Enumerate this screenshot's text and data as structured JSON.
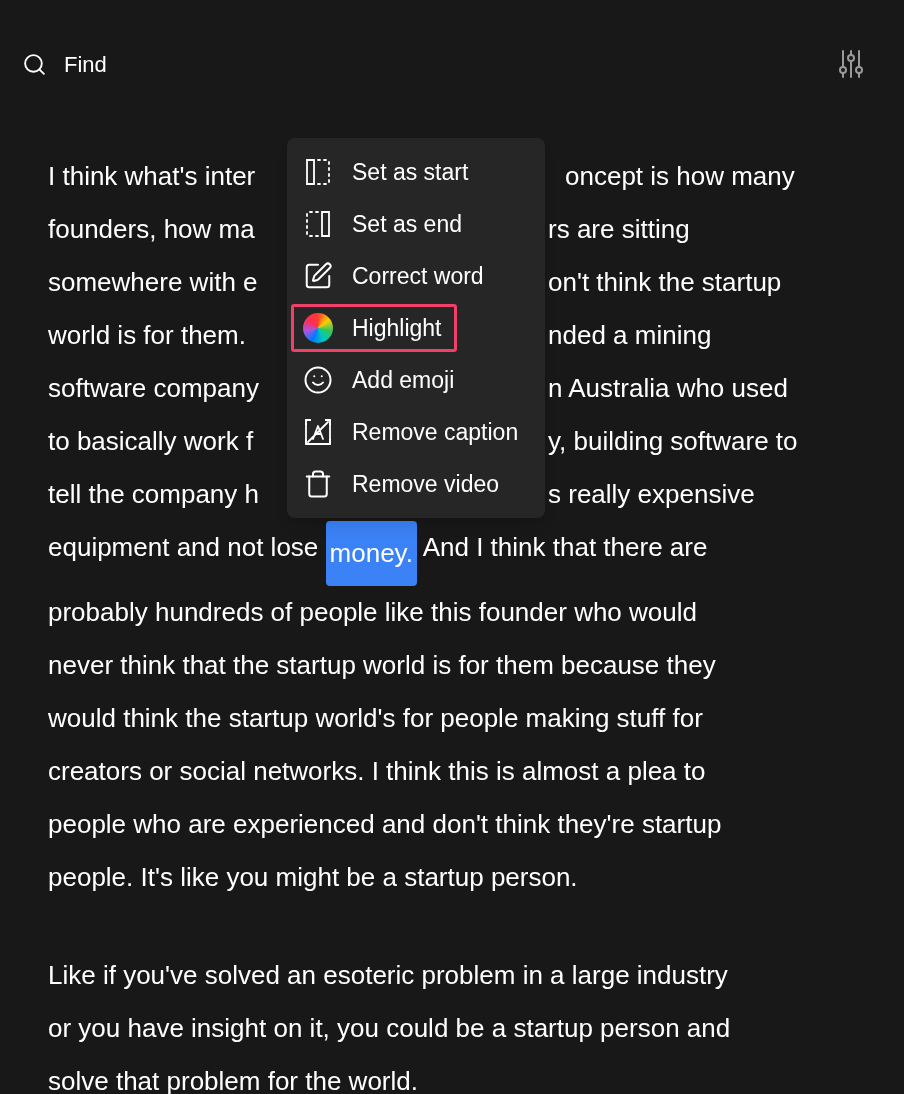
{
  "search": {
    "placeholder": "Find"
  },
  "transcript": [
    {
      "lines": [
        {
          "segments": [
            {
              "text": "I think what's inter",
              "selected": false
            }
          ],
          "beyond_menu": "oncept is how many"
        },
        {
          "segments": [
            {
              "text": "founders, how ma",
              "selected": false
            }
          ],
          "beyond_menu": "rs are sitting"
        },
        {
          "segments": [
            {
              "text": "somewhere with e",
              "selected": false
            }
          ],
          "beyond_menu": "on't think the startup"
        },
        {
          "segments": [
            {
              "text": "world is for them.",
              "selected": false
            }
          ],
          "beyond_menu": "nded a mining"
        },
        {
          "segments": [
            {
              "text": "software company",
              "selected": false
            }
          ],
          "beyond_menu": "n Australia who used"
        },
        {
          "segments": [
            {
              "text": "to basically work f",
              "selected": false
            }
          ],
          "beyond_menu": "y, building software to"
        },
        {
          "segments": [
            {
              "text": "tell the company h",
              "selected": false
            }
          ],
          "beyond_menu": "s really expensive"
        },
        {
          "segments": [
            {
              "text": "equipment and not lose ",
              "selected": false
            },
            {
              "text": "money.",
              "selected": true
            },
            {
              "text": " And I think that there are",
              "selected": false
            }
          ]
        },
        {
          "segments": [
            {
              "text": "probably hundreds of people like this founder who would",
              "selected": false
            }
          ]
        },
        {
          "segments": [
            {
              "text": "never think that the startup world is for them because they",
              "selected": false
            }
          ]
        },
        {
          "segments": [
            {
              "text": "would think the startup world's for people making stuff for",
              "selected": false
            }
          ]
        },
        {
          "segments": [
            {
              "text": "creators or social networks. I think this is almost a plea to",
              "selected": false
            }
          ]
        },
        {
          "segments": [
            {
              "text": "people who are experienced and don't think they're startup",
              "selected": false
            }
          ]
        },
        {
          "segments": [
            {
              "text": "people. It's like you might be a startup person.",
              "selected": false
            }
          ]
        }
      ]
    },
    {
      "lines": [
        {
          "segments": [
            {
              "text": "Like if you've solved an esoteric problem in a large industry",
              "selected": false
            }
          ]
        },
        {
          "segments": [
            {
              "text": "or you have insight on it, you could be a startup person and",
              "selected": false
            }
          ]
        },
        {
          "segments": [
            {
              "text": "solve that problem for the world.",
              "selected": false
            }
          ]
        }
      ]
    }
  ],
  "context_menu": {
    "items": [
      {
        "kind": "start",
        "label": "Set as start",
        "selected": false
      },
      {
        "kind": "end",
        "label": "Set as end",
        "selected": false
      },
      {
        "kind": "edit",
        "label": "Correct word",
        "selected": false
      },
      {
        "kind": "highlight",
        "label": "Highlight",
        "selected": true
      },
      {
        "kind": "emoji",
        "label": "Add emoji",
        "selected": false
      },
      {
        "kind": "caption",
        "label": "Remove caption",
        "selected": false
      },
      {
        "kind": "delete",
        "label": "Remove video",
        "selected": false
      }
    ]
  }
}
